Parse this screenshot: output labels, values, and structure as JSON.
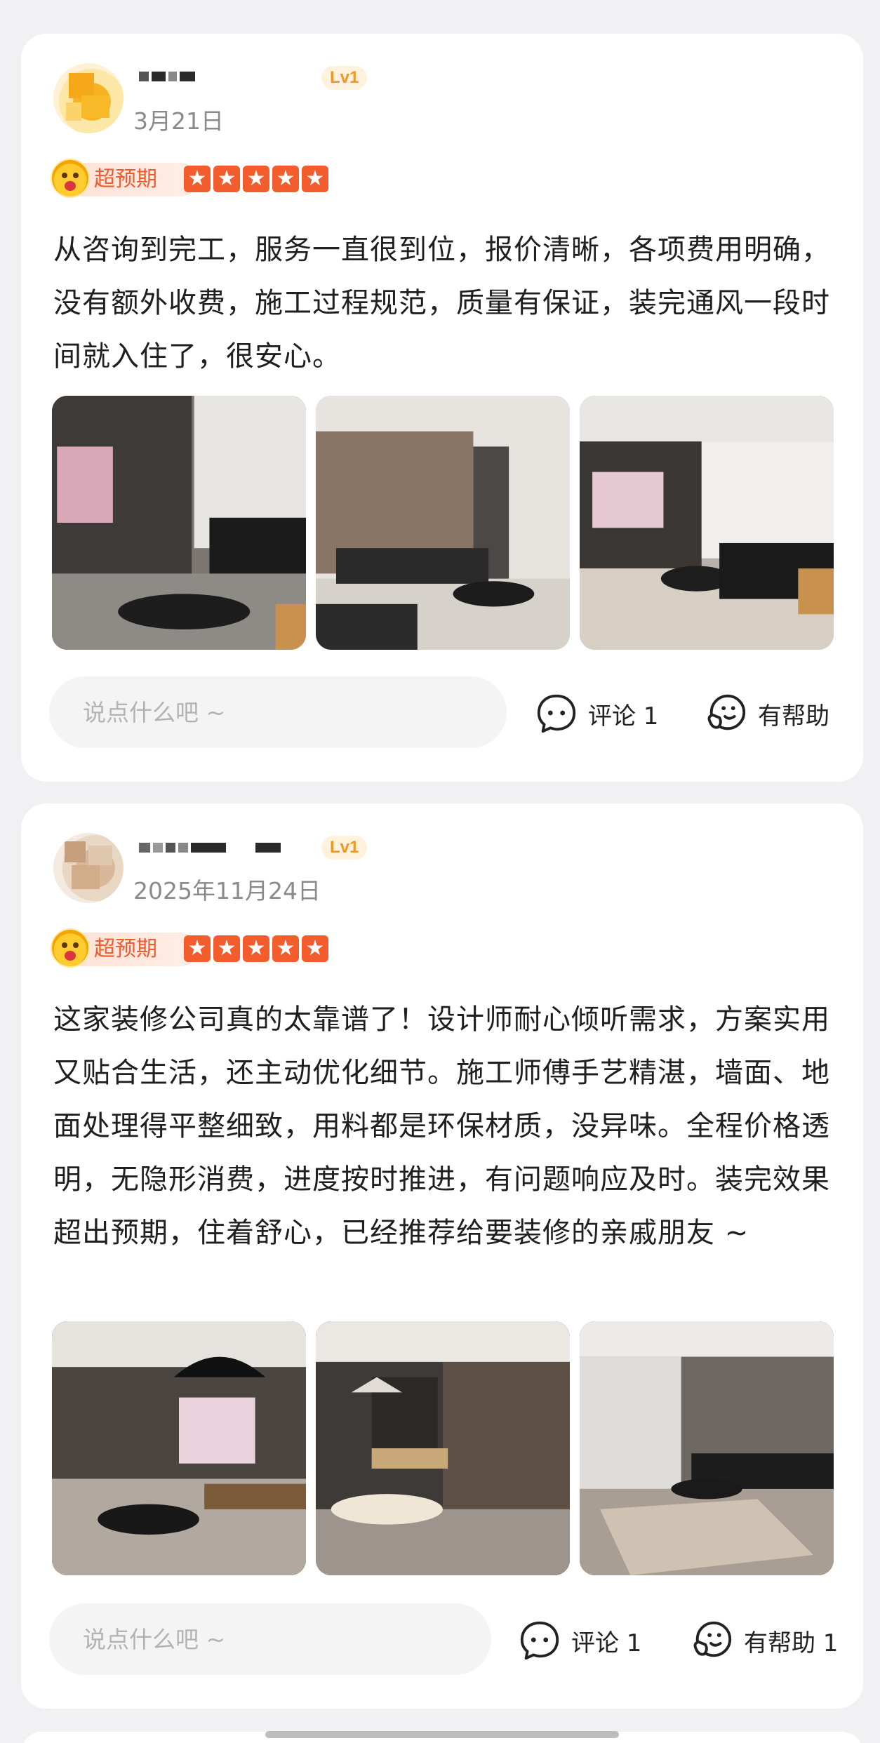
{
  "reviews": [
    {
      "date": "3月21日",
      "level": "Lv1",
      "expectation_label": "超预期",
      "rating": 5,
      "text": "从咨询到完工，服务一直很到位，报价清晰，各项费用明确，没有额外收费，施工过程规范，质量有保证，装完通风一段时间就入住了，很安心。",
      "comment_placeholder": "说点什么吧 ~",
      "comment_label": "评论 1",
      "helpful_label": "有帮助"
    },
    {
      "date": "2025年11月24日",
      "level": "Lv1",
      "expectation_label": "超预期",
      "rating": 5,
      "text": "这家装修公司真的太靠谱了！设计师耐心倾听需求，方案实用又贴合生活，还主动优化细节。施工师傅手艺精湛，墙面、地面处理得平整细致，用料都是环保材质，没异味。全程价格透明，无隐形消费，进度按时推进，有问题响应及时。装完效果超出预期，住着舒心，已经推荐给要装修的亲戚朋友 ~",
      "comment_placeholder": "说点什么吧 ~",
      "comment_label": "评论 1",
      "helpful_label": "有帮助 1"
    }
  ],
  "icons": {
    "star": "★",
    "comment": "comment-bubble-icon",
    "helpful": "helpful-face-icon",
    "expect": "surprised-face-icon"
  },
  "colors": {
    "star": "#f35c2c",
    "expect_text": "#ef5a2e",
    "level_text": "#e89a2c"
  }
}
